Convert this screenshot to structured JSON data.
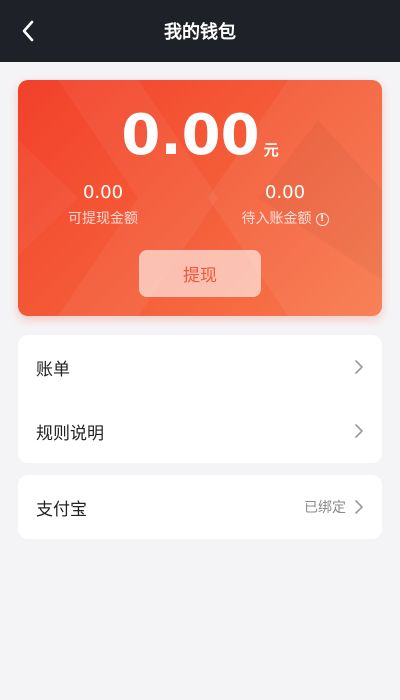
{
  "header": {
    "title": "我的钱包"
  },
  "wallet": {
    "total_amount": "0.00",
    "total_unit": "元",
    "withdrawable": {
      "value": "0.00",
      "label": "可提现金额"
    },
    "pending": {
      "value": "0.00",
      "label": "待入账金额",
      "info_symbol": "!"
    },
    "withdraw_label": "提现"
  },
  "menu": {
    "group1": [
      {
        "label": "账单"
      },
      {
        "label": "规则说明"
      }
    ],
    "group2": [
      {
        "label": "支付宝",
        "status": "已绑定"
      }
    ]
  },
  "colors": {
    "header_bg": "#1f2128",
    "card_gradient_start": "#f2402a",
    "card_gradient_end": "#f77a4e",
    "page_bg": "#f4f4f6"
  },
  "icons": [
    "chevron-left-icon",
    "info-icon",
    "chevron-right-icon"
  ]
}
